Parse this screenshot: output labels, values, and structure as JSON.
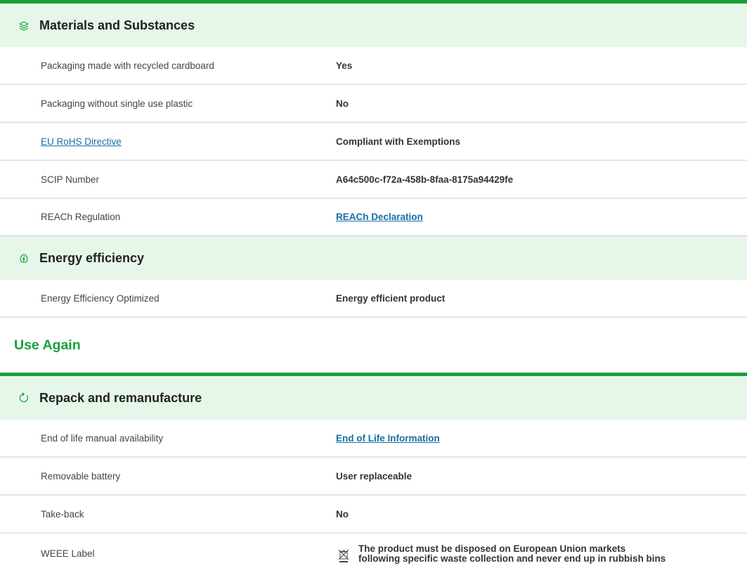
{
  "sections_top": [
    {
      "title": "Materials and Substances",
      "icon": "layers-leaf-icon",
      "rows": [
        {
          "label": "Packaging made with recycled cardboard",
          "value": "Yes"
        },
        {
          "label": "Packaging without single use plastic",
          "value": "No"
        },
        {
          "label": "EU RoHS Directive",
          "value": "Compliant with Exemptions"
        },
        {
          "label": "SCIP Number",
          "value": "A64c500c-f72a-458b-8faa-8175a94429fe"
        },
        {
          "label": "REACh Regulation",
          "value": "REACh Declaration"
        }
      ]
    },
    {
      "title": "Energy efficiency",
      "icon": "energy-leaf-icon",
      "rows": [
        {
          "label": "Energy Efficiency Optimized",
          "value": "Energy efficient product"
        }
      ]
    }
  ],
  "use_again": {
    "heading": "Use Again",
    "title": "Repack and remanufacture",
    "icon": "refresh-icon",
    "rows": [
      {
        "label": "End of life manual availability",
        "value": "End of Life Information"
      },
      {
        "label": "Removable battery",
        "value": "User replaceable"
      },
      {
        "label": "Take-back",
        "value": "No"
      },
      {
        "label": "WEEE Label",
        "value": "The product must be disposed on European Union markets following specific waste collection and never end up in rubbish bins",
        "icon": "crossed-bin-icon"
      }
    ]
  },
  "colors": {
    "accent": "#1a9e3a",
    "header_bg": "#e6f7ea",
    "link": "#1a6ea6"
  }
}
